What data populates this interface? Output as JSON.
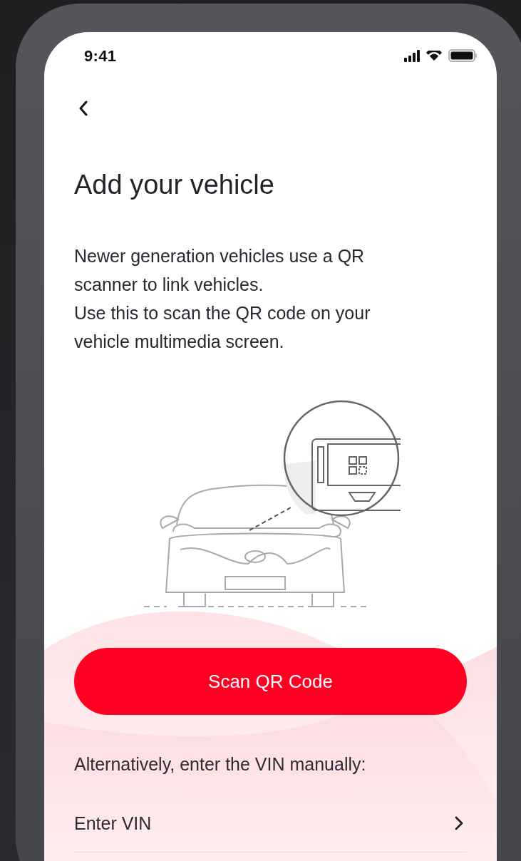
{
  "status_bar": {
    "time": "9:41"
  },
  "title": "Add your vehicle",
  "description": [
    "Newer generation vehicles use a QR scanner to link vehicles.",
    "Use this to scan the QR code on your vehicle multimedia screen."
  ],
  "primary_button": {
    "label": "Scan QR Code"
  },
  "alternative_text": "Alternatively, enter the VIN manually:",
  "options": [
    {
      "label": "Enter VIN"
    }
  ]
}
